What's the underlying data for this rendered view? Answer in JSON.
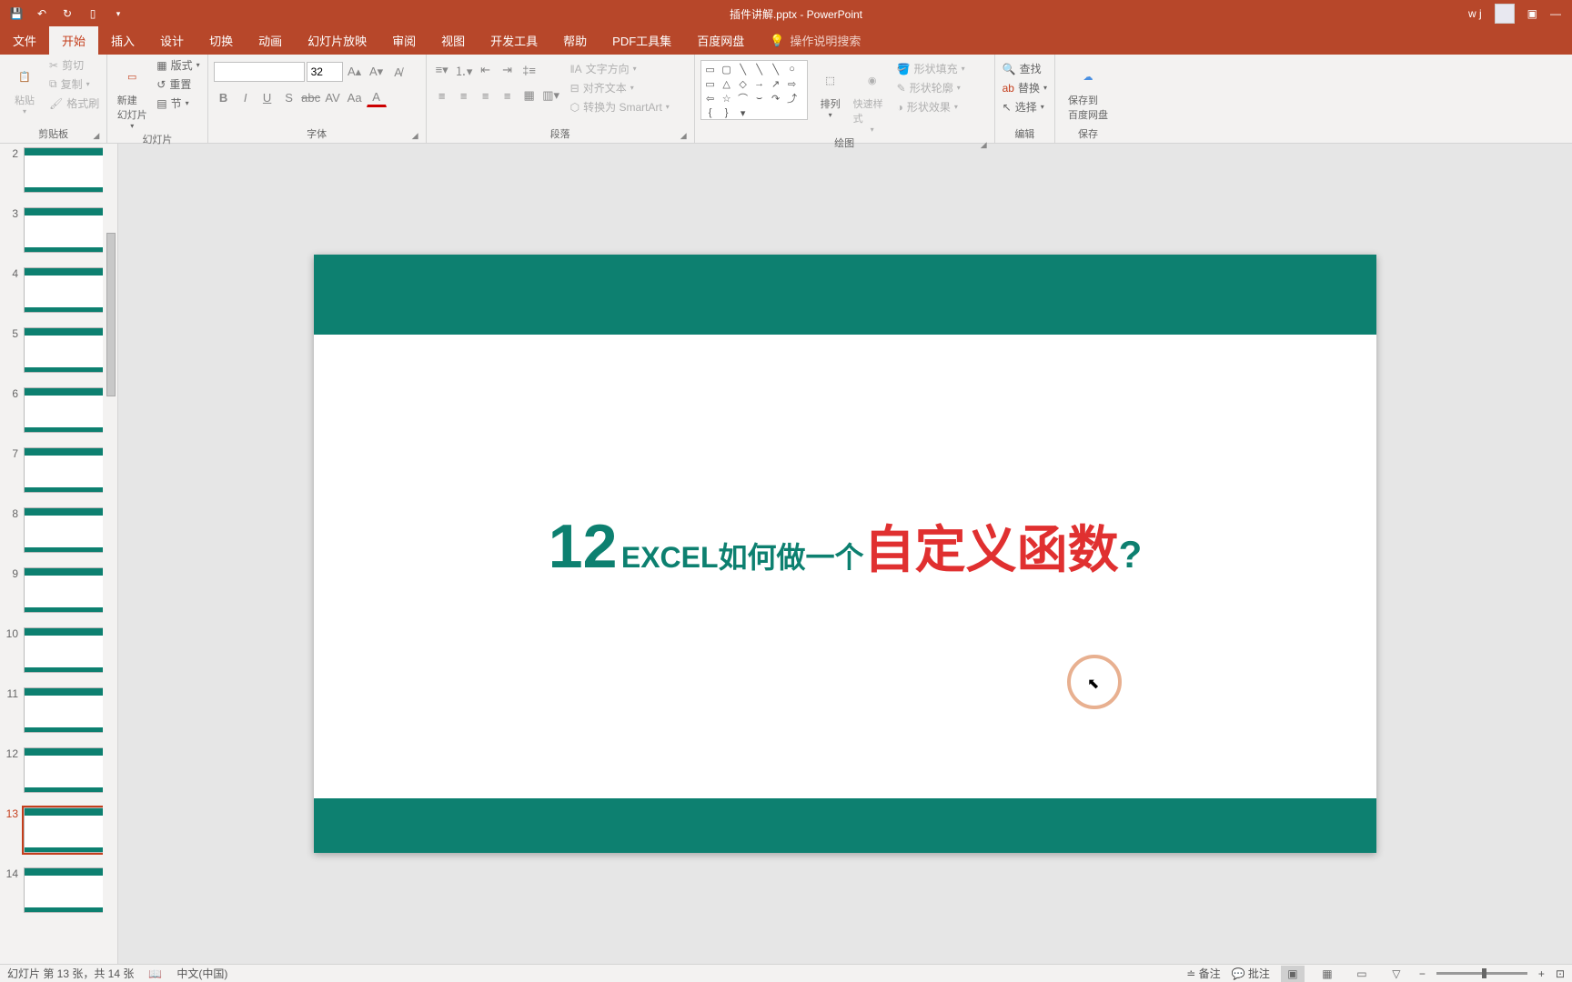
{
  "titlebar": {
    "title": "插件讲解.pptx - PowerPoint",
    "user": "w j"
  },
  "tabs": {
    "file": "文件",
    "home": "开始",
    "insert": "插入",
    "design": "设计",
    "transitions": "切换",
    "animations": "动画",
    "slideshow": "幻灯片放映",
    "review": "审阅",
    "view": "视图",
    "developer": "开发工具",
    "help": "帮助",
    "pdf": "PDF工具集",
    "baidu": "百度网盘",
    "tell": "操作说明搜索"
  },
  "ribbon": {
    "clipboard": {
      "paste": "粘贴",
      "cut": "剪切",
      "copy": "复制",
      "format_painter": "格式刷",
      "label": "剪贴板"
    },
    "slides": {
      "new_slide": "新建\n幻灯片",
      "layout": "版式",
      "reset": "重置",
      "section": "节",
      "label": "幻灯片"
    },
    "font": {
      "size": "32",
      "label": "字体"
    },
    "paragraph": {
      "text_direction": "文字方向",
      "align_text": "对齐文本",
      "smartart": "转换为 SmartArt",
      "label": "段落"
    },
    "drawing": {
      "arrange": "排列",
      "quick_styles": "快速样式",
      "shape_fill": "形状填充",
      "shape_outline": "形状轮廓",
      "shape_effects": "形状效果",
      "label": "绘图"
    },
    "editing": {
      "find": "查找",
      "replace": "替换",
      "select": "选择",
      "label": "编辑"
    },
    "save": {
      "save_to": "保存到\n百度网盘",
      "label": "保存"
    }
  },
  "thumbs": [
    "2",
    "3",
    "4",
    "5",
    "6",
    "7",
    "8",
    "9",
    "10",
    "11",
    "12",
    "13",
    "14"
  ],
  "active_thumb": 13,
  "slide": {
    "number": "12",
    "text1": "EXCEL如何做一个",
    "text2": "自定义函数",
    "text3": "?"
  },
  "statusbar": {
    "slide_info": "幻灯片 第 13 张，共 14 张",
    "language": "中文(中国)",
    "notes": "备注",
    "comments": "批注"
  }
}
